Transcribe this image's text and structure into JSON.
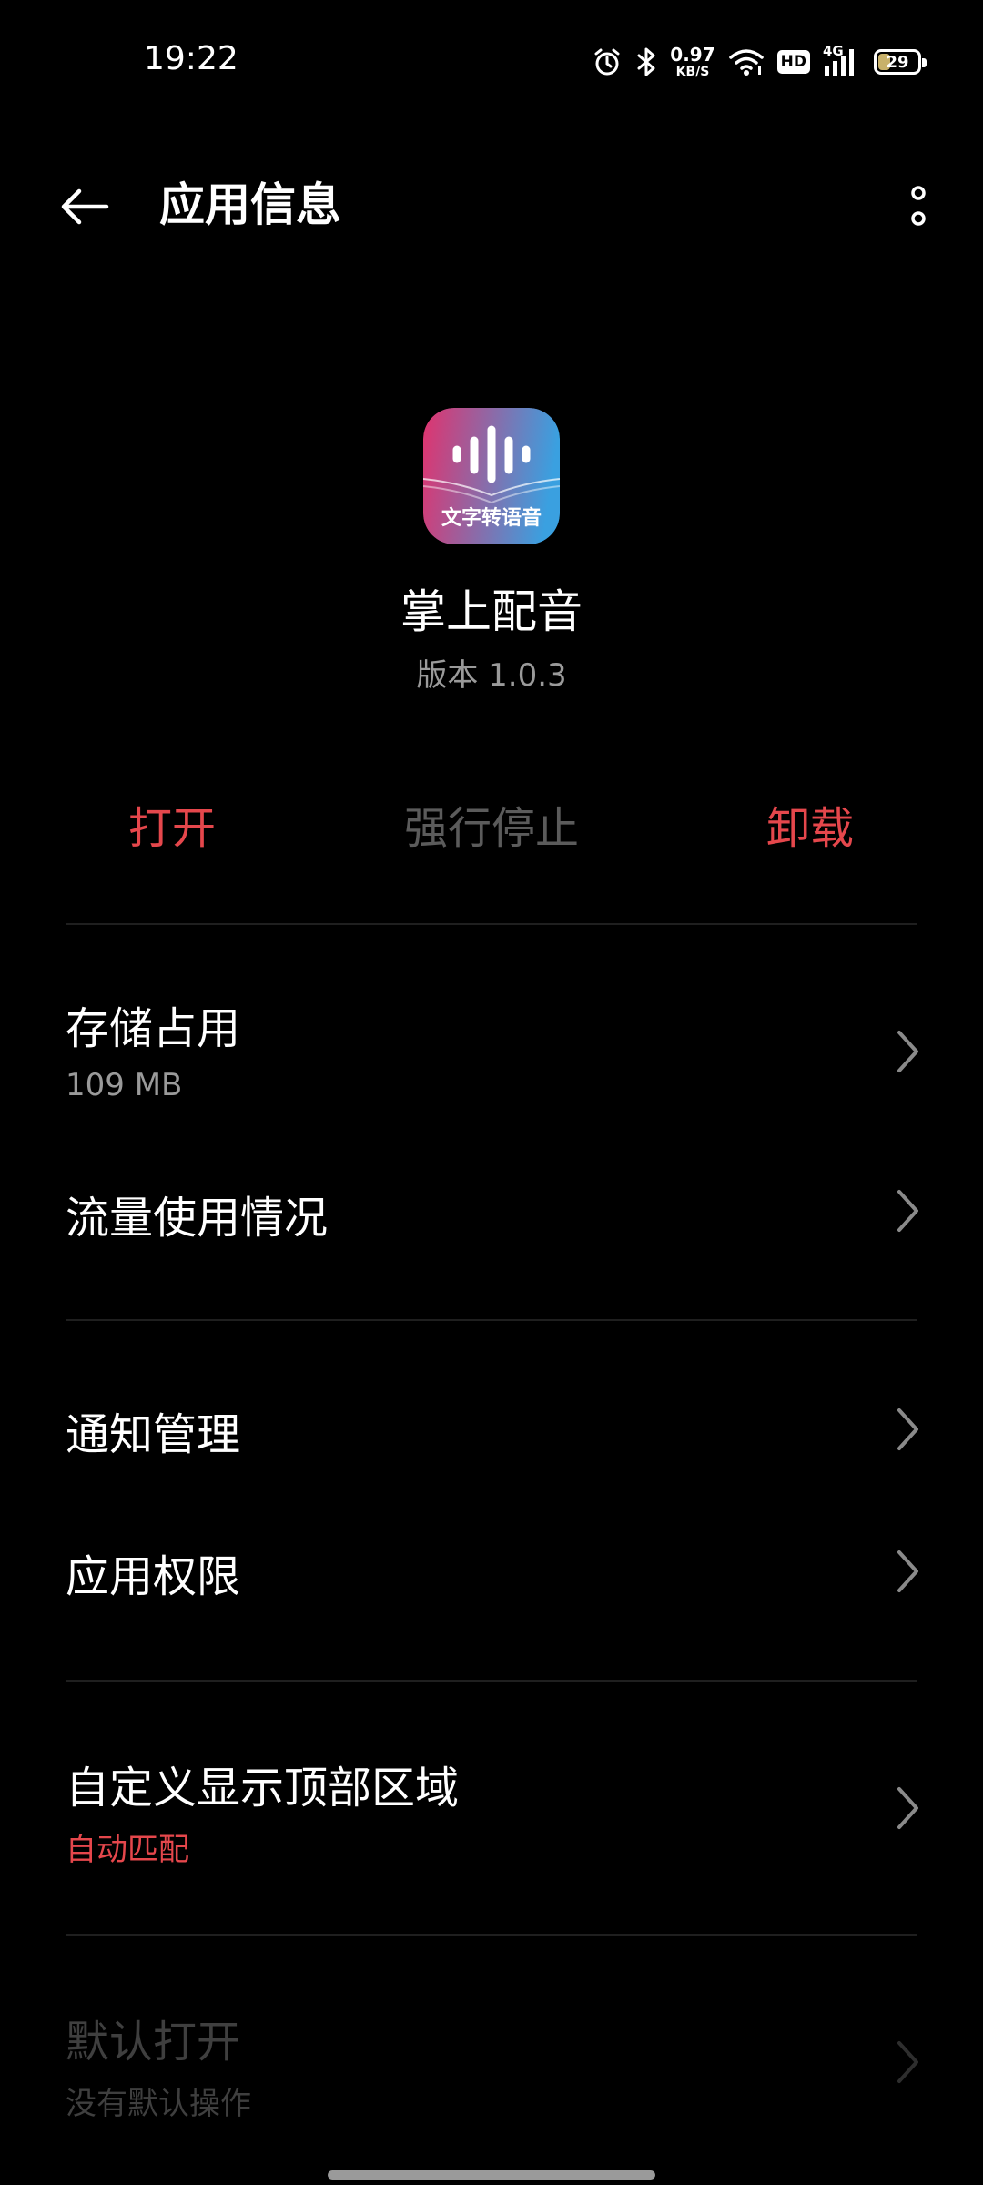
{
  "status_bar": {
    "time": "19:22",
    "net_speed_value": "0.97",
    "net_speed_unit": "KB/S",
    "hd_label": "HD",
    "network_type": "4G",
    "battery_percent": "29",
    "battery_level": 0.29,
    "icons": [
      "alarm-icon",
      "bluetooth-icon",
      "wifi-icon",
      "hd-icon",
      "cellular-signal-icon",
      "battery-icon"
    ]
  },
  "header": {
    "title": "应用信息",
    "icons": [
      "back-arrow-icon",
      "more-vertical-icon"
    ]
  },
  "app": {
    "name": "掌上配音",
    "version": "版本 1.0.3",
    "icon_caption": "文字转语音",
    "icon_colors": [
      "#e0336e",
      "#3aa0e0"
    ]
  },
  "actions": {
    "open": "打开",
    "force_stop": "强行停止",
    "uninstall": "卸载"
  },
  "settings": {
    "storage_title": "存储占用",
    "storage_value": "109 MB",
    "data_usage_title": "流量使用情况",
    "notifications_title": "通知管理",
    "permissions_title": "应用权限",
    "display_area_title": "自定义显示顶部区域",
    "display_area_value": "自动匹配",
    "default_open_title": "默认打开",
    "default_open_value": "没有默认操作"
  },
  "colors": {
    "background": "#000000",
    "accent_red": "#e5474c",
    "secondary_text": "#9a9a9a",
    "disabled_text": "#3f3f3f",
    "divider": "#1f1f1f"
  }
}
